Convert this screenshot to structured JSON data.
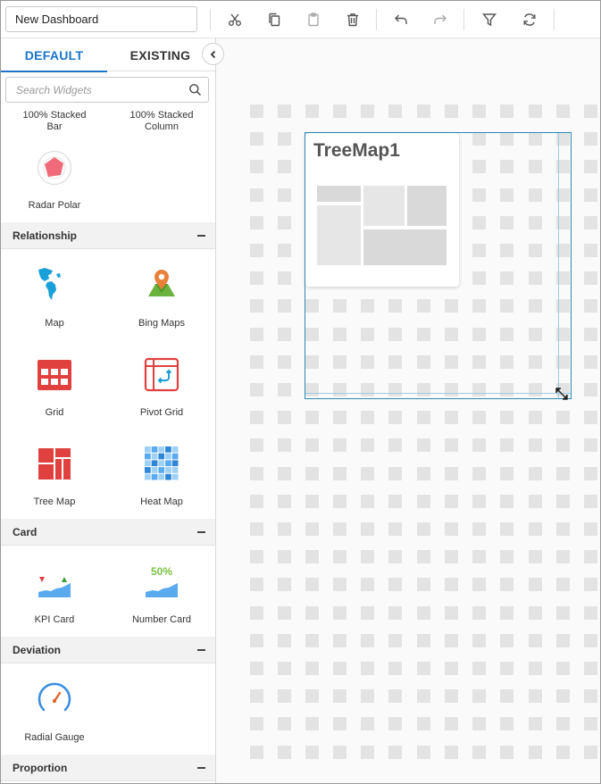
{
  "toolbar": {
    "title_value": "New Dashboard",
    "buttons": [
      "cut-icon",
      "copy-icon",
      "paste-icon",
      "delete-icon",
      "undo-icon",
      "redo-icon",
      "filter-icon",
      "refresh-icon"
    ]
  },
  "sidebar": {
    "tabs": [
      "DEFAULT",
      "EXISTING"
    ],
    "search_placeholder": "Search Widgets",
    "top_items": [
      {
        "label_line1": "100% Stacked",
        "label_line2": "Bar"
      },
      {
        "label_line1": "100% Stacked",
        "label_line2": "Column"
      }
    ],
    "radar_label": "Radar Polar",
    "categories": [
      {
        "name": "Relationship",
        "items": [
          "Map",
          "Bing Maps",
          "Grid",
          "Pivot Grid",
          "Tree Map",
          "Heat Map"
        ]
      },
      {
        "name": "Card",
        "items": [
          "KPI Card",
          "Number Card"
        ]
      },
      {
        "name": "Deviation",
        "items": [
          "Radial Gauge"
        ]
      },
      {
        "name": "Proportion",
        "items": []
      }
    ],
    "number_card_value": "50%"
  },
  "canvas": {
    "widget_title": "TreeMap1"
  },
  "colors": {
    "accent": "#1a74c9",
    "selection": "#2a8ab2",
    "grid_red": "#e0413f",
    "map_blue": "#1aa0d8"
  }
}
